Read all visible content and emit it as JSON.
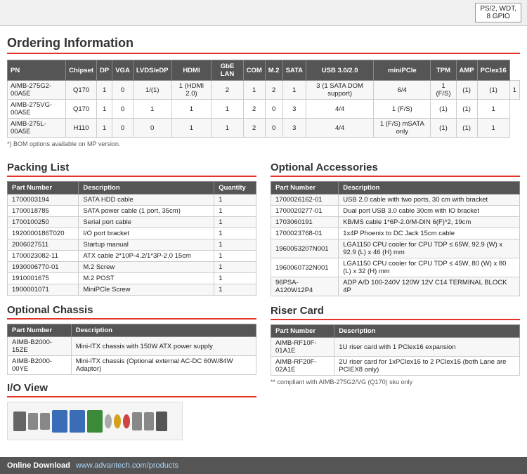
{
  "topbar": {
    "ps2_label": "PS/2, WDT,",
    "gpio_label": "8 GPIO"
  },
  "ordering": {
    "title": "Ordering Information",
    "columns": [
      "PN",
      "Chipset",
      "DP",
      "VGA",
      "LVDS/eDP",
      "HDMI",
      "GbE LAN",
      "COM",
      "M.2",
      "SATA",
      "USB 3.0/2.0",
      "miniPCle",
      "TPM",
      "AMP",
      "PClex16"
    ],
    "rows": [
      [
        "AIMB-275G2-00A5E",
        "Q170",
        "1",
        "0",
        "1/(1)",
        "1 (HDMI 2.0)",
        "2",
        "1",
        "2",
        "1",
        "3 (1 SATA DOM support)",
        "6/4",
        "1 (F/S)",
        "(1)",
        "(1)",
        "1"
      ],
      [
        "AIMB-275VG-00A5E",
        "Q170",
        "1",
        "0",
        "1",
        "1",
        "1",
        "2",
        "0",
        "3",
        "4/4",
        "1 (F/S)",
        "(1)",
        "(1)",
        "1"
      ],
      [
        "AIMB-275L-00A5E",
        "H110",
        "1",
        "0",
        "0",
        "1",
        "1",
        "2",
        "0",
        "3",
        "4/4",
        "1 (F/S) mSATA only",
        "(1)",
        "(1)",
        "1"
      ]
    ],
    "footnote": "*) BOM options available on MP version."
  },
  "packing_list": {
    "title": "Packing List",
    "columns": [
      "Part Number",
      "Description",
      "Quantity"
    ],
    "rows": [
      [
        "1700003194",
        "SATA HDD cable",
        "1"
      ],
      [
        "1700018785",
        "SATA power cable (1 port, 35cm)",
        "1"
      ],
      [
        "1700100250",
        "Serial port cable",
        "1"
      ],
      [
        "1920000186T020",
        "I/O port bracket",
        "1"
      ],
      [
        "2006027511",
        "Startup manual",
        "1"
      ],
      [
        "1700023082-11",
        "ATX cable 2*10P-4.2/1*3P-2.0 15cm",
        "1"
      ],
      [
        "1930006770-01",
        "M.2 Screw",
        "1"
      ],
      [
        "1910001675",
        "M.2 POST",
        "1"
      ],
      [
        "1900001071",
        "MiniPCle Screw",
        "1"
      ]
    ]
  },
  "optional_chassis": {
    "title": "Optional Chassis",
    "columns": [
      "Part Number",
      "Description"
    ],
    "rows": [
      [
        "AIMB-B2000-15ZE",
        "Mini-ITX chassis with 150W ATX power supply"
      ],
      [
        "AIMB-B2000-00YE",
        "Mini-ITX chassis (Optional external AC-DC 60W/84W Adaptor)"
      ]
    ]
  },
  "optional_accessories": {
    "title": "Optional Accessories",
    "columns": [
      "Part Number",
      "Description"
    ],
    "rows": [
      [
        "1700026162-01",
        "USB 2.0 cable with two ports, 30 cm with bracket"
      ],
      [
        "1700020277-01",
        "Dual port USB 3.0 cable 30cm with IO bracket"
      ],
      [
        "1703060191",
        "KB/MS cable 1*6P-2.0/M-DIN 6(F)*2, 19cm"
      ],
      [
        "1700023768-01",
        "1x4P Phoenix to DC Jack 15cm cable"
      ],
      [
        "1960053207N001",
        "LGA1150 CPU cooler for CPU TDP ≤ 65W, 92.9 (W) x 92.9 (L) x 46 (H) mm"
      ],
      [
        "1960060732N001",
        "LGA1150 CPU cooler for CPU TDP ≤ 45W, 80 (W) x 80 (L) x 32 (H) mm"
      ],
      [
        "96PSA-A120W12P4",
        "ADP A/D 100-240V 120W 12V C14 TERMINAL BLOCK 4P"
      ]
    ]
  },
  "riser_card": {
    "title": "Riser Card",
    "columns": [
      "Part Number",
      "Description"
    ],
    "rows": [
      [
        "AIMB-RF10F-01A1E",
        "1U riser card with 1 PClex16 expansion"
      ],
      [
        "AIMB-RF20F-02A1E",
        "2U riser card for 1xPClex16 to 2 PClex16 (both Lane are PCIEX8 only)"
      ]
    ],
    "footnote": "** compliant with AIMB-275G2/VG (Q170) sku only"
  },
  "io_view": {
    "title": "I/O View"
  },
  "online_download": {
    "label": "Online Download",
    "url": "www.advantech.com/products"
  }
}
